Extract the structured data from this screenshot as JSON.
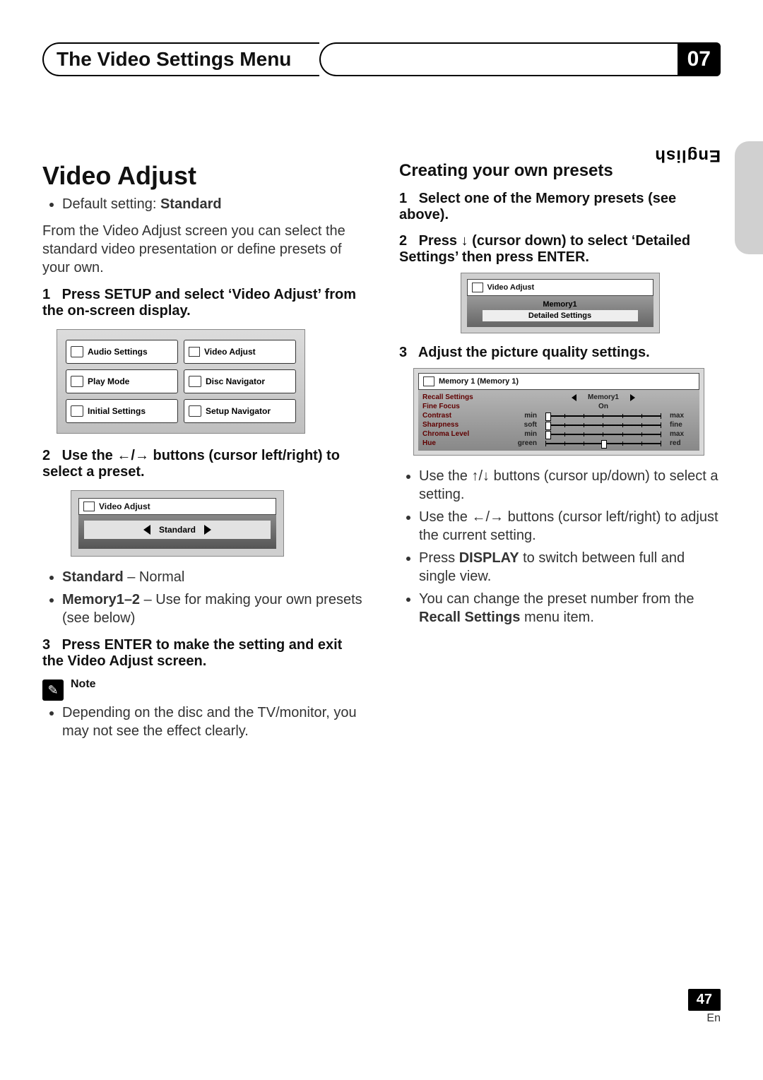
{
  "header": {
    "chapter_title": "The Video Settings Menu",
    "chapter_number": "07"
  },
  "language_tab": "English",
  "left": {
    "h1": "Video Adjust",
    "default_prefix": "Default setting: ",
    "default_value": "Standard",
    "intro": "From the Video Adjust screen you can select the standard video presentation or define presets of your own.",
    "step1": "Press SETUP and select ‘Video Adjust’ from the on-screen display.",
    "osd_buttons": [
      "Audio Settings",
      "Video Adjust",
      "Play Mode",
      "Disc Navigator",
      "Initial Settings",
      "Setup Navigator"
    ],
    "step2_a": "Use the ",
    "step2_b": " buttons (cursor left/right) to select a preset.",
    "osd2_title": "Video Adjust",
    "osd2_selected": "Standard",
    "preset_list": {
      "item1_name": "Standard",
      "item1_desc": " – Normal",
      "item2_name": "Memory1–2",
      "item2_desc": " – Use for making your own presets (see below)"
    },
    "step3": "Press ENTER to make the setting and exit the Video Adjust screen.",
    "note_label": "Note",
    "note_text": "Depending on the disc and the TV/monitor, you may not see the effect clearly."
  },
  "right": {
    "h2": "Creating your own presets",
    "step1": "Select one of the Memory presets (see above).",
    "step2_a": "Press ",
    "step2_b": " (cursor down) to select ‘Detailed Settings’ then press ENTER.",
    "osd3_title": "Video Adjust",
    "osd3_line1": "Memory1",
    "osd3_line2": "Detailed Settings",
    "step3": "Adjust the picture quality settings.",
    "osd4_title": "Memory 1 (Memory 1)",
    "osd4_rows": {
      "recall": {
        "label": "Recall Settings",
        "value": "Memory1"
      },
      "fine": {
        "label": "Fine Focus",
        "value": "On"
      },
      "contrast": {
        "label": "Contrast",
        "left": "min",
        "right": "max",
        "pos": 0
      },
      "sharp": {
        "label": "Sharpness",
        "left": "soft",
        "right": "fine",
        "pos": 0
      },
      "chroma": {
        "label": "Chroma Level",
        "left": "min",
        "right": "max",
        "pos": 0
      },
      "hue": {
        "label": "Hue",
        "left": "green",
        "right": "red",
        "pos": 50
      }
    },
    "bullets": {
      "b1_a": "Use the ",
      "b1_b": " buttons (cursor up/down) to select a setting.",
      "b2_a": "Use the ",
      "b2_b": " buttons (cursor left/right) to adjust the current setting.",
      "b3_a": "Press ",
      "b3_key": "DISPLAY",
      "b3_b": " to switch between full and single view.",
      "b4_a": "You can change the preset number from the ",
      "b4_key": "Recall Settings",
      "b4_b": " menu item."
    }
  },
  "footer": {
    "page": "47",
    "lang": "En"
  }
}
